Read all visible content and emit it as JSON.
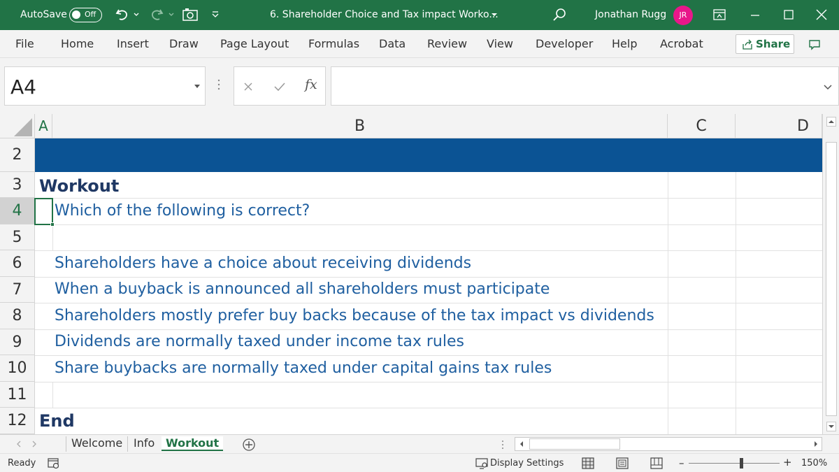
{
  "titlebar": {
    "autosave_label": "AutoSave",
    "autosave_state": "Off",
    "doc_title": "6. Shareholder Choice and Tax impact Worko...",
    "user_name": "Jonathan Rugg",
    "user_initials": "JR",
    "accent": "#217346",
    "avatar_color": "#e8178a"
  },
  "ribbon": {
    "tabs": [
      "File",
      "Home",
      "Insert",
      "Draw",
      "Page Layout",
      "Formulas",
      "Data",
      "Review",
      "View",
      "Developer",
      "Help",
      "Acrobat"
    ],
    "share_label": "Share"
  },
  "formula_bar": {
    "name_box": "A4",
    "fx_label": "fx",
    "formula_value": ""
  },
  "grid": {
    "columns": [
      "A",
      "B",
      "C",
      "D"
    ],
    "rows": [
      "2",
      "3",
      "4",
      "5",
      "6",
      "7",
      "8",
      "9",
      "10",
      "11",
      "12"
    ],
    "banner_color": "#0b5394",
    "cells": {
      "r3": "Workout",
      "r4": "Which of the following is correct?",
      "r6": "Shareholders have a choice about receiving dividends",
      "r7": "When a buyback is announced all shareholders must participate",
      "r8": "Shareholders mostly prefer buy backs because of the tax impact vs dividends",
      "r9": "Dividends are normally taxed under income tax rules",
      "r10": "Share buybacks are normally taxed under capital gains tax rules",
      "r12": "End"
    }
  },
  "sheets": {
    "tabs": [
      "Welcome",
      "Info",
      "Workout"
    ],
    "active": "Workout"
  },
  "status": {
    "ready": "Ready",
    "display_settings": "Display Settings",
    "zoom_minus": "–",
    "zoom_plus": "+",
    "zoom": "150%"
  }
}
